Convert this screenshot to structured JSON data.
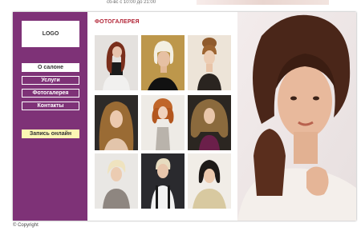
{
  "header": {
    "hours_text": "сб-вс с 10:00 до 21:00"
  },
  "logo": {
    "label": "LOGO"
  },
  "nav": {
    "items": [
      {
        "label": "О салоне",
        "active": true
      },
      {
        "label": "Услуги",
        "active": false
      },
      {
        "label": "Фотогалерея",
        "active": false
      },
      {
        "label": "Контакты",
        "active": false
      }
    ],
    "booking_label": "Запись онлайн"
  },
  "gallery": {
    "title": "ФОТОГАЛЕРЕЯ",
    "photos": [
      {
        "subject": "long-auburn-hair-portrait"
      },
      {
        "subject": "platinum-bob-portrait"
      },
      {
        "subject": "updo-bun-portrait"
      },
      {
        "subject": "long-wavy-hair-portrait"
      },
      {
        "subject": "red-curly-hair-portrait"
      },
      {
        "subject": "voluminous-curls-portrait"
      },
      {
        "subject": "short-blonde-hair-portrait"
      },
      {
        "subject": "short-dark-hair-portrait"
      },
      {
        "subject": "dark-bob-portrait"
      }
    ]
  },
  "hero": {
    "subject": "woman-with-brown-curls"
  },
  "footer": {
    "copyright": "© Copyright"
  },
  "colors": {
    "sidebar": "#7e3277",
    "title": "#b12234",
    "booking_button": "#fbf6b4"
  }
}
